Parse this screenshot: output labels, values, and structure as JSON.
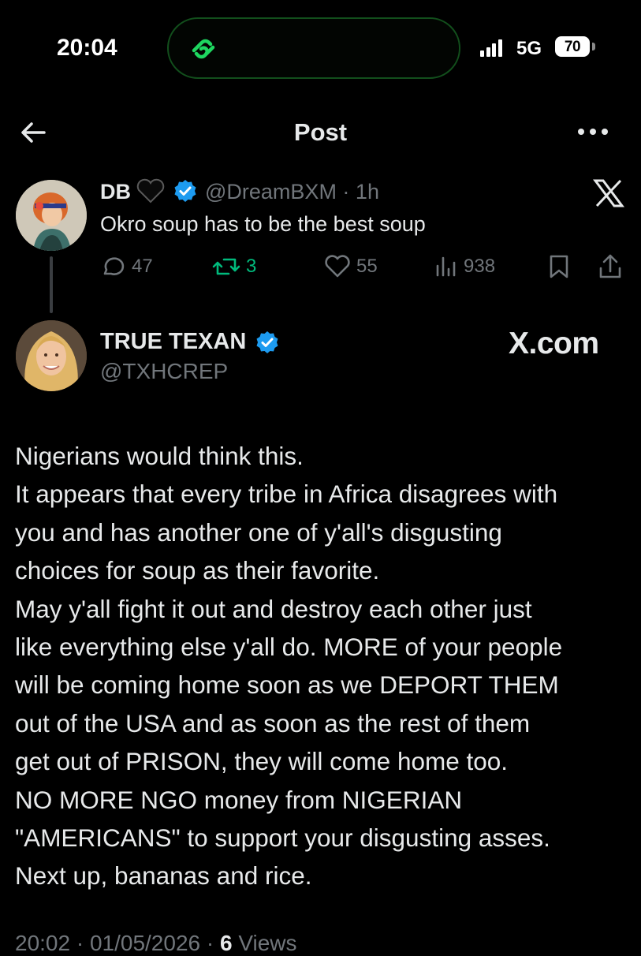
{
  "status_bar": {
    "time": "20:04",
    "network": "5G",
    "battery": "70",
    "icons": [
      "app-link-icon",
      "signal-icon",
      "battery-icon"
    ]
  },
  "header": {
    "title": "Post",
    "icons": [
      "back-arrow-icon",
      "more-icon"
    ]
  },
  "quoted_post": {
    "name": "DB",
    "handle_time": "@DreamBXM · 1h",
    "text": "Okro soup has to be the best soup",
    "actions": {
      "replies": "47",
      "reposts": "3",
      "likes": "55",
      "views": "938"
    },
    "icons": [
      "black-heart-icon",
      "verified-icon",
      "x-logo-icon",
      "reply-icon",
      "repost-icon",
      "like-icon",
      "views-icon",
      "bookmark-icon",
      "share-icon"
    ]
  },
  "main_post": {
    "name": "TRUE TEXAN",
    "handle": "@TXHCREP",
    "brand": "X.com",
    "lines": [
      "Nigerians would think this.",
      "It appears that every tribe in Africa disagrees with",
      "you and has another one of y'all's disgusting",
      "choices for soup as their favorite.",
      "May y'all fight it out and destroy each other just",
      "like everything else y'all do. MORE of your people",
      "will be coming home soon as we DEPORT THEM",
      "out of the USA and as soon as the rest of them",
      "get out of PRISON, they will come home too.",
      "NO MORE NGO money from NIGERIAN",
      "\"AMERICANS\" to support your disgusting asses.",
      "Next up, bananas and rice."
    ],
    "meta_time": "20:02 · 01/05/2026 · ",
    "meta_views_count": "6",
    "meta_views_label": " Views"
  },
  "colors": {
    "background": "#000000",
    "text": "#e7e9ea",
    "muted": "#71767b",
    "repost_green": "#00ba7c",
    "verified_blue": "#1d9bf0",
    "island_green": "#1ed760"
  }
}
